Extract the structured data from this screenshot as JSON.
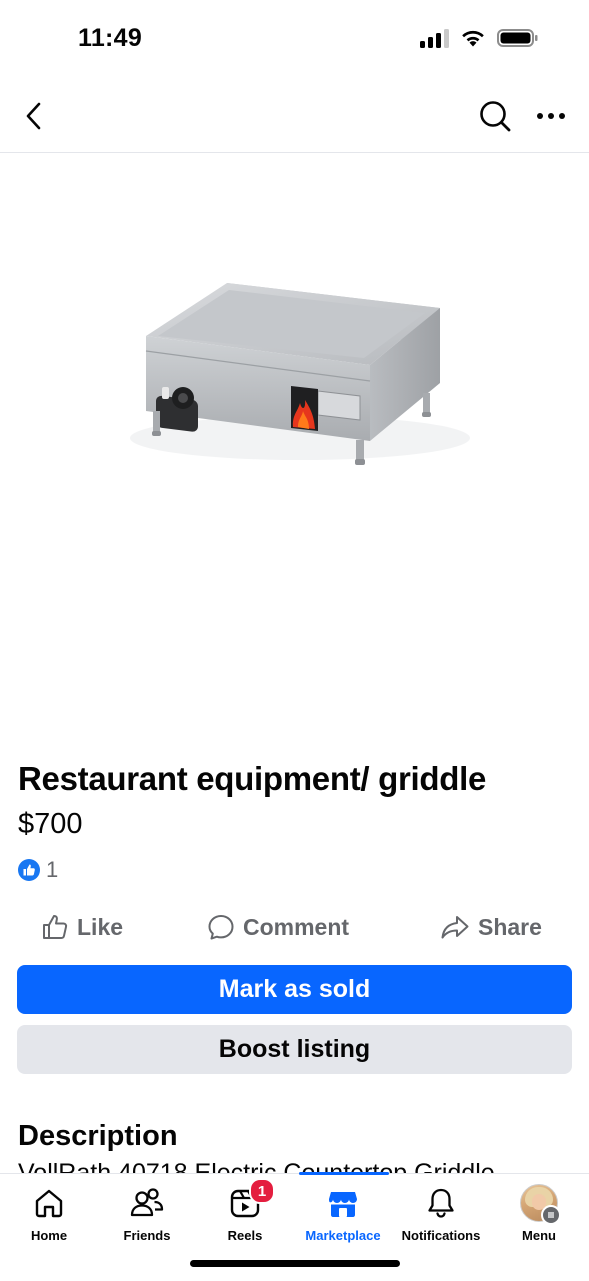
{
  "status_bar": {
    "time": "11:49",
    "signal_icon": "cellular-signal-icon",
    "wifi_icon": "wifi-icon",
    "battery_icon": "battery-icon"
  },
  "top_nav": {
    "back_icon": "chevron-left-icon",
    "search_icon": "search-icon",
    "more_icon": "more-horizontal-icon"
  },
  "listing": {
    "image_subject": "griddle-image",
    "title": "Restaurant equipment/ griddle",
    "price": "$700",
    "reaction_count": "1",
    "reaction_icon": "like-reaction-icon",
    "actions": {
      "like": "Like",
      "comment": "Comment",
      "share": "Share"
    },
    "mark_sold_label": "Mark as sold",
    "boost_label": "Boost listing",
    "description_heading": "Description",
    "description_text": "VollRath 40718 Electric Countertop Griddle"
  },
  "tabbar": {
    "items": [
      {
        "label": "Home",
        "icon": "home-icon"
      },
      {
        "label": "Friends",
        "icon": "friends-icon"
      },
      {
        "label": "Reels",
        "icon": "reels-icon",
        "badge": "1"
      },
      {
        "label": "Marketplace",
        "icon": "marketplace-icon",
        "active": true
      },
      {
        "label": "Notifications",
        "icon": "bell-icon"
      },
      {
        "label": "Menu",
        "icon": "avatar"
      }
    ]
  },
  "colors": {
    "primary": "#0866ff",
    "secondary_button": "#e4e6eb",
    "badge": "#e41e3f",
    "muted_text": "#65676b"
  }
}
